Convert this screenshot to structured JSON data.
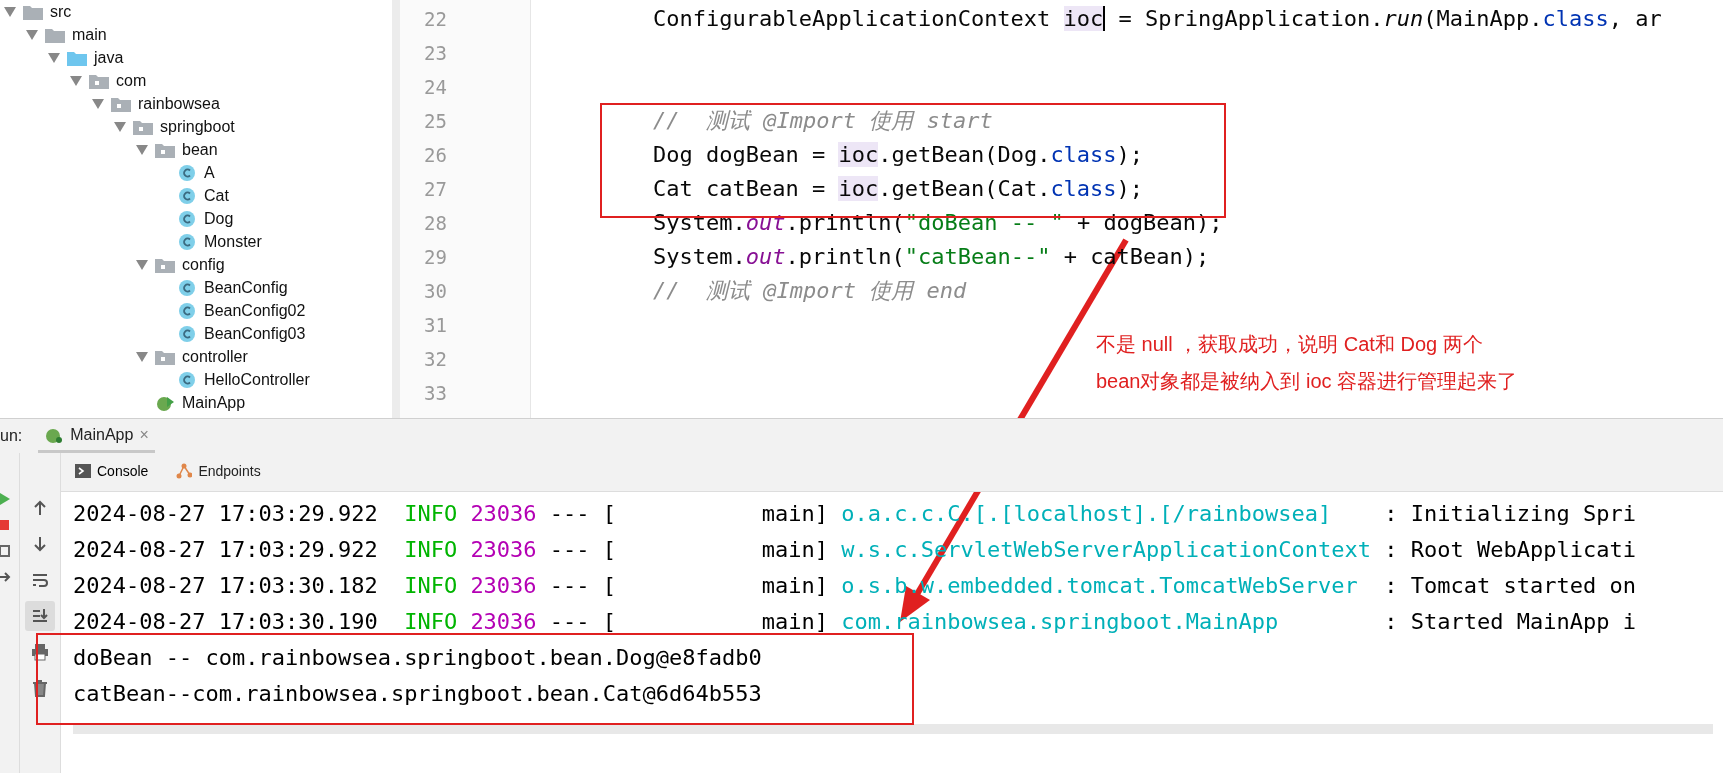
{
  "project_tree": [
    {
      "label": "src",
      "kind": "folder",
      "expanded": true,
      "children": [
        {
          "label": "main",
          "kind": "folder",
          "expanded": true,
          "children": [
            {
              "label": "java",
              "kind": "source-folder",
              "expanded": true,
              "children": [
                {
                  "label": "com",
                  "kind": "package",
                  "expanded": true,
                  "children": [
                    {
                      "label": "rainbowsea",
                      "kind": "package",
                      "expanded": true,
                      "children": [
                        {
                          "label": "springboot",
                          "kind": "package",
                          "expanded": true,
                          "children": [
                            {
                              "label": "bean",
                              "kind": "package",
                              "expanded": true,
                              "children": [
                                {
                                  "label": "A",
                                  "kind": "class"
                                },
                                {
                                  "label": "Cat",
                                  "kind": "class"
                                },
                                {
                                  "label": "Dog",
                                  "kind": "class"
                                },
                                {
                                  "label": "Monster",
                                  "kind": "class"
                                }
                              ]
                            },
                            {
                              "label": "config",
                              "kind": "package",
                              "expanded": true,
                              "children": [
                                {
                                  "label": "BeanConfig",
                                  "kind": "class"
                                },
                                {
                                  "label": "BeanConfig02",
                                  "kind": "class"
                                },
                                {
                                  "label": "BeanConfig03",
                                  "kind": "class"
                                }
                              ]
                            },
                            {
                              "label": "controller",
                              "kind": "package",
                              "expanded": true,
                              "children": [
                                {
                                  "label": "HelloController",
                                  "kind": "class"
                                }
                              ]
                            },
                            {
                              "label": "MainApp",
                              "kind": "app"
                            }
                          ]
                        }
                      ]
                    }
                  ]
                }
              ]
            }
          ]
        }
      ]
    }
  ],
  "editor": {
    "lines": [
      {
        "number": "22",
        "tokens": [
          {
            "kind": "plain",
            "text": "ConfigurableApplicationContext "
          },
          {
            "kind": "caret-highlight",
            "text": "ioc"
          },
          {
            "kind": "plain",
            "text": " = SpringApplication."
          },
          {
            "kind": "static-method",
            "text": "run"
          },
          {
            "kind": "plain",
            "text": "(MainApp."
          },
          {
            "kind": "keyword",
            "text": "class"
          },
          {
            "kind": "plain",
            "text": ", ar"
          }
        ]
      },
      {
        "number": "23"
      },
      {
        "number": "24"
      },
      {
        "number": "25",
        "tokens": [
          {
            "kind": "comment",
            "text": "//  测试 @Import 使用 start"
          }
        ]
      },
      {
        "number": "26",
        "tokens": [
          {
            "kind": "plain",
            "text": "Dog dogBean = "
          },
          {
            "kind": "highlight",
            "text": "ioc"
          },
          {
            "kind": "plain",
            "text": ".getBean(Dog."
          },
          {
            "kind": "keyword",
            "text": "class"
          },
          {
            "kind": "plain",
            "text": ");"
          }
        ]
      },
      {
        "number": "27",
        "tokens": [
          {
            "kind": "plain",
            "text": "Cat catBean = "
          },
          {
            "kind": "highlight",
            "text": "ioc"
          },
          {
            "kind": "plain",
            "text": ".getBean(Cat."
          },
          {
            "kind": "keyword",
            "text": "class"
          },
          {
            "kind": "plain",
            "text": ");"
          }
        ]
      },
      {
        "number": "28",
        "tokens": [
          {
            "kind": "plain",
            "text": "System."
          },
          {
            "kind": "static-field",
            "text": "out"
          },
          {
            "kind": "plain",
            "text": ".println("
          },
          {
            "kind": "string",
            "text": "\"doBean -- \""
          },
          {
            "kind": "plain",
            "text": " + dogBean);"
          }
        ]
      },
      {
        "number": "29",
        "tokens": [
          {
            "kind": "plain",
            "text": "System."
          },
          {
            "kind": "static-field",
            "text": "out"
          },
          {
            "kind": "plain",
            "text": ".println("
          },
          {
            "kind": "string",
            "text": "\"catBean--\""
          },
          {
            "kind": "plain",
            "text": " + catBean);"
          }
        ]
      },
      {
        "number": "30",
        "tokens": [
          {
            "kind": "comment",
            "text": "//  测试 @Import 使用 end"
          }
        ]
      },
      {
        "number": "31"
      },
      {
        "number": "32"
      },
      {
        "number": "33"
      }
    ]
  },
  "annotation": {
    "note_lines": [
      "不是 null ，获取成功，说明 Cat和 Dog 两个",
      "bean对象都是被纳入到 ioc 容器进行管理起来了"
    ]
  },
  "run_bar": {
    "label": "un:",
    "tabs": [
      {
        "label": "MainApp",
        "close": "×",
        "selected": true
      }
    ]
  },
  "console_tabs": [
    {
      "label": "Console",
      "kind": "console",
      "selected": true
    },
    {
      "label": "Endpoints",
      "kind": "endpoints",
      "selected": false
    }
  ],
  "toolbar": [
    {
      "kind": "up",
      "selected": false
    },
    {
      "kind": "down",
      "selected": false
    },
    {
      "kind": "wrap",
      "selected": false
    },
    {
      "kind": "scroll-end",
      "selected": true
    },
    {
      "kind": "print",
      "selected": false
    },
    {
      "kind": "trash",
      "selected": false
    }
  ],
  "console": [
    {
      "kind": "log",
      "timestamp": "2024-08-27 17:03:29.922",
      "level": "INFO",
      "pid": "23036",
      "thread": "--- [           main]",
      "logger": "o.a.c.c.C.[.[localhost].[/rainbowsea]",
      "message": ": Initializing Spri"
    },
    {
      "kind": "log",
      "timestamp": "2024-08-27 17:03:29.922",
      "level": "INFO",
      "pid": "23036",
      "thread": "--- [           main]",
      "logger": "w.s.c.ServletWebServerApplicationContext",
      "message": ": Root WebApplicati"
    },
    {
      "kind": "log",
      "timestamp": "2024-08-27 17:03:30.182",
      "level": "INFO",
      "pid": "23036",
      "thread": "--- [           main]",
      "logger": "o.s.b.w.embedded.tomcat.TomcatWebServer",
      "message": ": Tomcat started on"
    },
    {
      "kind": "log",
      "timestamp": "2024-08-27 17:03:30.190",
      "level": "INFO",
      "pid": "23036",
      "thread": "--- [           main]",
      "logger": "com.rainbowsea.springboot.MainApp",
      "message": ": Started MainApp i"
    },
    {
      "kind": "output",
      "text": "doBean -- com.rainbowsea.springboot.bean.Dog@e8fadb0"
    },
    {
      "kind": "output",
      "text": "catBean--com.rainbowsea.springboot.bean.Cat@6d64b553"
    }
  ]
}
